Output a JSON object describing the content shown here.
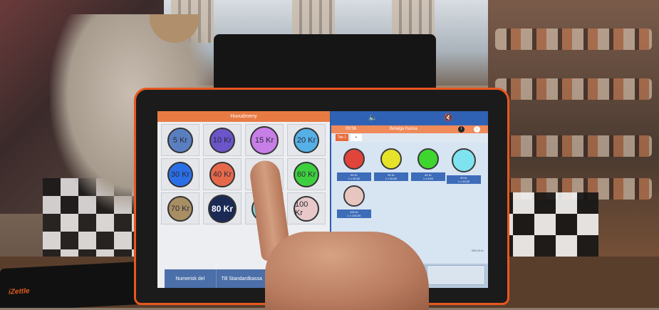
{
  "pos": {
    "menu_title": "Huvudmeny",
    "coins": [
      {
        "label": "5 Kr",
        "color": "#5a7fc0"
      },
      {
        "label": "10 Kr",
        "color": "#6b55c8"
      },
      {
        "label": "15 Kr",
        "color": "#c77ee6"
      },
      {
        "label": "20 Kr",
        "color": "#55b0e6"
      },
      {
        "label": "30 Kr",
        "color": "#2a6fe6"
      },
      {
        "label": "40 Kr",
        "color": "#e6684a"
      },
      {
        "label": "",
        "color": "#e6e23a"
      },
      {
        "label": "60 Kr",
        "color": "#3ecf3e"
      },
      {
        "label": "70 Kr",
        "color": "#a88e63"
      },
      {
        "label": "80 Kr",
        "color": "#1a2a55"
      },
      {
        "label": "",
        "color": "#6fd8e0"
      },
      {
        "label": "100 Kr",
        "color": "#e8c8c8"
      }
    ],
    "footer": {
      "numeric_label": "Numerisk del",
      "standard_label": "Till Standardkassa"
    },
    "cart": {
      "time": "09:56",
      "title": "Betalga Kassa",
      "tabs": [
        "Tab 1"
      ],
      "items": [
        {
          "color": "#e0443a",
          "line1": "60 Kr",
          "line2": "1 x 60,00"
        },
        {
          "color": "#e6e22a",
          "line1": "50 Kr",
          "line2": "1 x 50,00"
        },
        {
          "color": "#3ed62e",
          "line1": "60 Kr",
          "line2": "1 x 6,00"
        },
        {
          "color": "#7fe3ef",
          "line1": "90 Kr",
          "line2": "1 x 90,00"
        },
        {
          "color": "#e8c6c0",
          "line1": "100 Kr",
          "line2": "1 x 100,00"
        }
      ],
      "total": "390,00 Kr"
    },
    "card_reader_brand": "iZettle"
  }
}
